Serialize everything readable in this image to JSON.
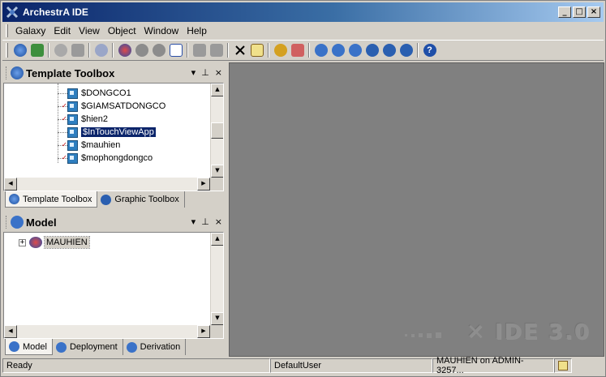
{
  "window": {
    "title": "ArchestrA IDE",
    "minimize": "_",
    "maximize": "□",
    "close": "×"
  },
  "menu": [
    "Galaxy",
    "Edit",
    "View",
    "Object",
    "Window",
    "Help"
  ],
  "toolbar": {
    "icons": [
      "galaxy-icon",
      "import-icon",
      "check-in-icon",
      "save-icon",
      "link-icon",
      "deploy-icon",
      "undeploy-icon",
      "redeploy-icon",
      "validate-icon",
      "new-template-icon",
      "new-instance-icon",
      "delete-icon",
      "properties-icon",
      "user-icon",
      "config-icon",
      "model-view-icon",
      "deployment-view-icon",
      "derivation-view-icon",
      "graphic-toolbox-icon",
      "checkmark-icon",
      "network-icon",
      "help-icon"
    ]
  },
  "template_toolbox": {
    "title": "Template Toolbox",
    "pin": "⊥",
    "close": "×",
    "menu": "▾",
    "items": [
      {
        "label": "$DONGCO1",
        "checked": false,
        "selected": false
      },
      {
        "label": "$GIAMSATDONGCO",
        "checked": true,
        "selected": false
      },
      {
        "label": "$hien2",
        "checked": true,
        "selected": false
      },
      {
        "label": "$InTouchViewApp",
        "checked": false,
        "selected": true
      },
      {
        "label": "$mauhien",
        "checked": true,
        "selected": false
      },
      {
        "label": "$mophongdongco",
        "checked": true,
        "selected": false
      }
    ],
    "tabs": [
      {
        "label": "Template Toolbox",
        "active": true
      },
      {
        "label": "Graphic Toolbox",
        "active": false
      }
    ]
  },
  "model": {
    "title": "Model",
    "pin": "⊥",
    "close": "×",
    "menu": "▾",
    "root": {
      "label": "MAUHIEN",
      "expander": "+"
    },
    "tabs": [
      {
        "label": "Model",
        "active": true
      },
      {
        "label": "Deployment",
        "active": false
      },
      {
        "label": "Derivation",
        "active": false
      }
    ]
  },
  "workspace": {
    "watermark": "IDE 3.0"
  },
  "status": {
    "left": "Ready",
    "user": "DefaultUser",
    "galaxy": "MAUHIEN  on  ADMIN-3257..."
  },
  "colors": {
    "title_start": "#0a246a",
    "title_end": "#a6caf0",
    "selection": "#0a246a",
    "workspace": "#808080"
  }
}
